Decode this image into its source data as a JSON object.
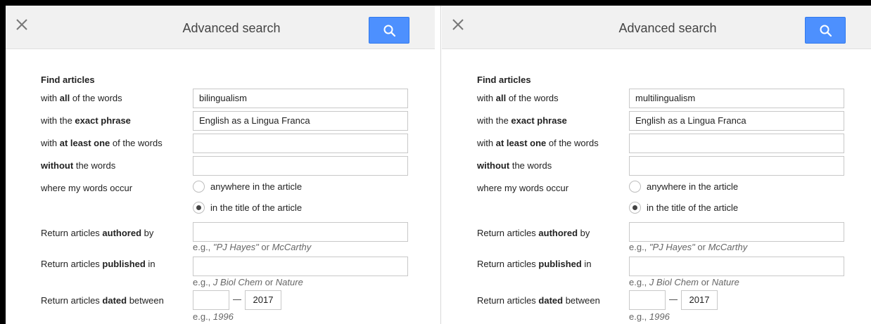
{
  "panels": [
    {
      "header": {
        "title": "Advanced search",
        "close_icon": "close-icon",
        "search_icon": "search-icon"
      },
      "form": {
        "section_title": "Find articles",
        "all_words": {
          "prefix": "with ",
          "bold": "all",
          "suffix": " of the words",
          "value": "bilingualism"
        },
        "exact_phrase": {
          "prefix": "with the ",
          "bold": "exact phrase",
          "suffix": "",
          "value": "English as a Lingua Franca"
        },
        "at_least_one": {
          "prefix": "with ",
          "bold": "at least one",
          "suffix": " of the words",
          "value": ""
        },
        "without_words": {
          "prefix": "",
          "bold": "without",
          "suffix": " the words",
          "value": ""
        },
        "where_label": "where my words occur",
        "where_options": [
          "anywhere in the article",
          "in the title of the article"
        ],
        "where_selected": 1,
        "authored": {
          "prefix": "Return articles ",
          "bold": "authored",
          "suffix": " by",
          "value": "",
          "hint_prefix": "e.g., ",
          "hint_em1": "\"PJ Hayes\"",
          "hint_mid": " or ",
          "hint_em2": "McCarthy"
        },
        "published": {
          "prefix": "Return articles ",
          "bold": "published",
          "suffix": " in",
          "value": "",
          "hint_prefix": "e.g., ",
          "hint_em1": "J Biol Chem",
          "hint_mid": " or ",
          "hint_em2": "Nature"
        },
        "dated": {
          "prefix": "Return articles ",
          "bold": "dated",
          "suffix": " between",
          "from": "",
          "to": "2017",
          "hint_prefix": "e.g., ",
          "hint_em": "1996"
        }
      }
    },
    {
      "header": {
        "title": "Advanced search",
        "close_icon": "close-icon",
        "search_icon": "search-icon"
      },
      "form": {
        "section_title": "Find articles",
        "all_words": {
          "prefix": "with ",
          "bold": "all",
          "suffix": " of the words",
          "value": "multilingualism"
        },
        "exact_phrase": {
          "prefix": "with the ",
          "bold": "exact phrase",
          "suffix": "",
          "value": "English as a Lingua Franca"
        },
        "at_least_one": {
          "prefix": "with ",
          "bold": "at least one",
          "suffix": " of the words",
          "value": ""
        },
        "without_words": {
          "prefix": "",
          "bold": "without",
          "suffix": " the words",
          "value": ""
        },
        "where_label": "where my words occur",
        "where_options": [
          "anywhere in the article",
          "in the title of the article"
        ],
        "where_selected": 1,
        "authored": {
          "prefix": "Return articles ",
          "bold": "authored",
          "suffix": " by",
          "value": "",
          "hint_prefix": "e.g., ",
          "hint_em1": "\"PJ Hayes\"",
          "hint_mid": " or ",
          "hint_em2": "McCarthy"
        },
        "published": {
          "prefix": "Return articles ",
          "bold": "published",
          "suffix": " in",
          "value": "",
          "hint_prefix": "e.g., ",
          "hint_em1": "J Biol Chem",
          "hint_mid": " or ",
          "hint_em2": "Nature"
        },
        "dated": {
          "prefix": "Return articles ",
          "bold": "dated",
          "suffix": " between",
          "from": "",
          "to": "2017",
          "hint_prefix": "e.g., ",
          "hint_em": "1996"
        }
      }
    }
  ],
  "colors": {
    "accent": "#4d90fe",
    "header_bg": "#f1f1f1",
    "frame": "#000000"
  }
}
